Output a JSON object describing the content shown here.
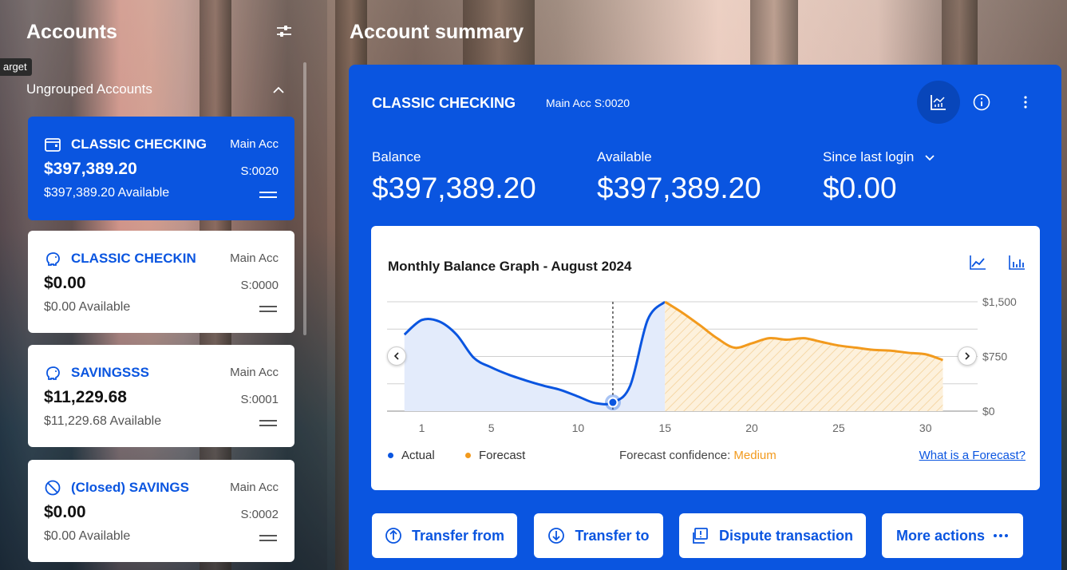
{
  "tooltip": "arget",
  "accounts_panel": {
    "title": "Accounts",
    "group_label": "Ungrouped Accounts",
    "cards": [
      {
        "name": "CLASSIC CHECKING",
        "type": "Main Acc",
        "balance": "$397,389.20",
        "code": "S:0020",
        "available": "$397,389.20 Available",
        "icon": "wallet-icon",
        "selected": true
      },
      {
        "name": "CLASSIC CHECKIN",
        "type": "Main Acc",
        "balance": "$0.00",
        "code": "S:0000",
        "available": "$0.00 Available",
        "icon": "piggy-bank-icon",
        "selected": false
      },
      {
        "name": "SAVINGSSS",
        "type": "Main Acc",
        "balance": "$11,229.68",
        "code": "S:0001",
        "available": "$11,229.68 Available",
        "icon": "piggy-bank-icon",
        "selected": false
      },
      {
        "name": "(Closed) SAVINGS",
        "type": "Main Acc",
        "balance": "$0.00",
        "code": "S:0002",
        "available": "$0.00 Available",
        "icon": "closed-icon",
        "selected": false
      }
    ]
  },
  "summary": {
    "title": "Account summary",
    "account_name": "CLASSIC CHECKING",
    "account_meta": "Main Acc  S:0020",
    "balance_label": "Balance",
    "balance_value": "$397,389.20",
    "available_label": "Available",
    "available_value": "$397,389.20",
    "since_label": "Since last login",
    "since_value": "$0.00"
  },
  "graph": {
    "title": "Monthly Balance Graph - August 2024",
    "legend_actual": "Actual",
    "legend_forecast": "Forecast",
    "confidence_label": "Forecast confidence: ",
    "confidence_value": "Medium",
    "forecast_link": "What is a Forecast?"
  },
  "chart_data": {
    "type": "line",
    "title": "Monthly Balance Graph - August 2024",
    "x_ticks": [
      1,
      5,
      10,
      15,
      20,
      25,
      30
    ],
    "y_ticks": [
      "$0",
      "$750",
      "$1,500"
    ],
    "ylim": [
      0,
      1500
    ],
    "xlim": [
      -1,
      33
    ],
    "selected_day": 12,
    "series": [
      {
        "name": "Actual",
        "color": "#0a55e0",
        "x": [
          0,
          1,
          2,
          3,
          4,
          5,
          6,
          7,
          8,
          9,
          10,
          11,
          12,
          13,
          14,
          15
        ],
        "y": [
          1050,
          1250,
          1230,
          1050,
          730,
          600,
          500,
          420,
          350,
          290,
          200,
          110,
          120,
          350,
          1250,
          1500
        ]
      },
      {
        "name": "Forecast",
        "color": "#f29a1d",
        "x": [
          15,
          16,
          17,
          18,
          19,
          20,
          21,
          22,
          23,
          24,
          25,
          26,
          27,
          28,
          29,
          30,
          31
        ],
        "y": [
          1500,
          1350,
          1180,
          1000,
          870,
          930,
          1000,
          980,
          1000,
          950,
          900,
          870,
          840,
          830,
          800,
          780,
          700
        ]
      }
    ]
  },
  "actions": {
    "transfer_from": "Transfer from",
    "transfer_to": "Transfer to",
    "dispute": "Dispute transaction",
    "more": "More actions"
  }
}
